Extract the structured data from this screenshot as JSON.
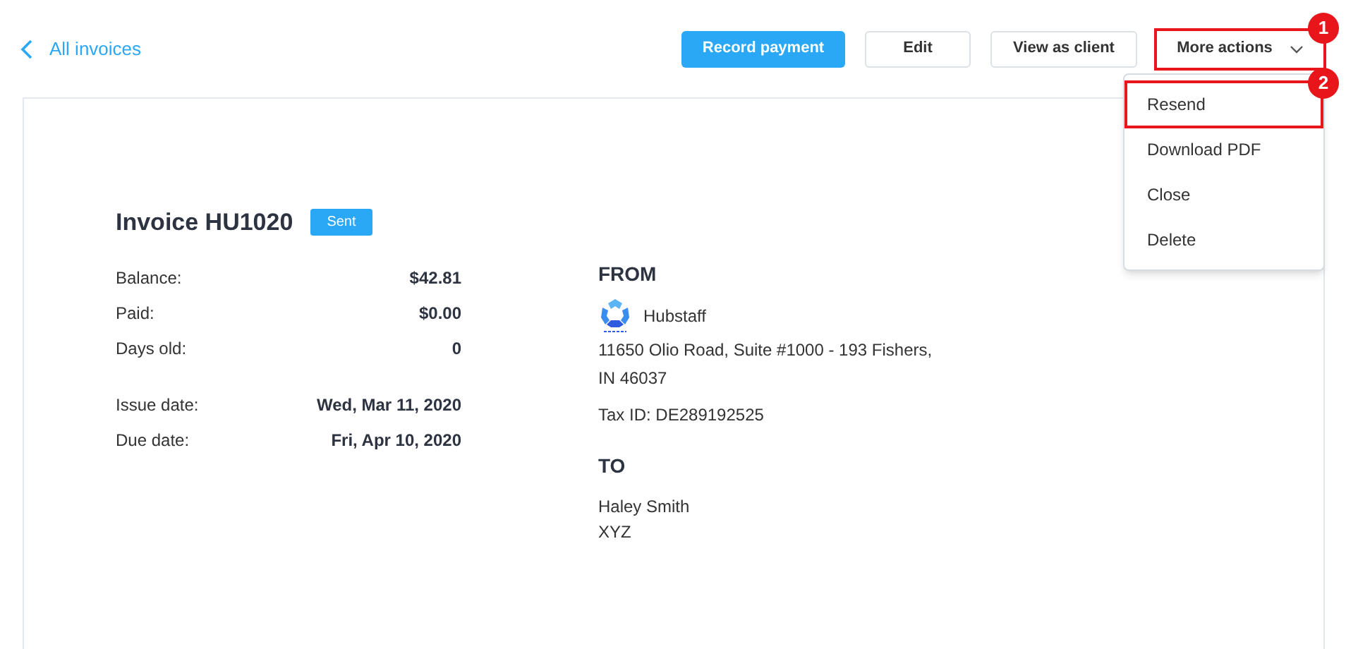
{
  "back_link": {
    "label": "All invoices"
  },
  "actions": [
    {
      "label": "Record payment",
      "kind": "primary"
    },
    {
      "label": "Edit",
      "kind": "outline"
    },
    {
      "label": "View as client",
      "kind": "outline"
    },
    {
      "label": "More actions",
      "kind": "dropdown",
      "expanded": true,
      "callout": "1"
    }
  ],
  "menu": [
    {
      "label": "Resend",
      "callout": "2"
    },
    {
      "label": "Download PDF"
    },
    {
      "label": "Close"
    },
    {
      "label": "Delete"
    }
  ],
  "invoice": {
    "title": "Invoice HU1020",
    "status": "Sent",
    "summary": [
      {
        "label": "Balance:",
        "value": "$42.81"
      },
      {
        "label": "Paid:",
        "value": "$0.00"
      },
      {
        "label": "Days old:",
        "value": "0"
      }
    ],
    "dates": [
      {
        "label": "Issue date:",
        "value": "Wed, Mar 11, 2020"
      },
      {
        "label": "Due date:",
        "value": "Fri, Apr 10, 2020"
      }
    ],
    "from": {
      "heading": "FROM",
      "company": "Hubstaff",
      "address": [
        "11650 Olio Road, Suite #1000 - 193 Fishers,",
        "IN 46037"
      ],
      "tax_id": "Tax ID: DE289192525"
    },
    "to": {
      "heading": "TO",
      "lines": [
        "Haley Smith",
        "XYZ"
      ]
    }
  }
}
